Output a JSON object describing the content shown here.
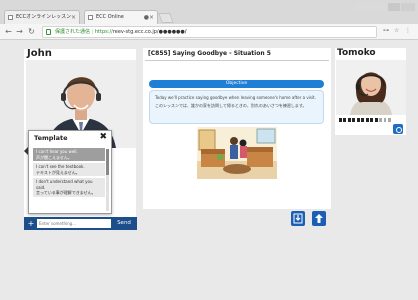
{
  "browser": {
    "tabs": [
      {
        "label": "ECCオンラインレッスン"
      },
      {
        "label": "ECC Online"
      }
    ],
    "address": {
      "secure_label": "保護された通信",
      "protocol": "https://",
      "url_host": "reev-stg.ecc.co.jp/",
      "url_masked": "●●●●●●/"
    }
  },
  "left_panel": {
    "name": "John"
  },
  "template_popup": {
    "title": "Template",
    "items": [
      {
        "en": "I can't hear you well.",
        "ja": "声が聞こえません。"
      },
      {
        "en": "I can't see the textbook.",
        "ja": "テキストが見えません。"
      },
      {
        "en": "I don't understand what you said.",
        "ja": "言っている事が理解できません。"
      }
    ]
  },
  "chat": {
    "placeholder": "Enter something...",
    "send_label": "Send"
  },
  "center_panel": {
    "title": "[C855] Saying Goodbye - Situation 5",
    "objective_label": "Objective",
    "objective_en": "Today we'll practice saying goodbye when leaving someone's home after a visit.",
    "objective_ja": "このレッスンでは、誰かの家を訪問して帰るときの、別れのあいさつを練習します。"
  },
  "right_panel": {
    "name": "Tomoko",
    "volume_level": 0.75
  },
  "icons": {
    "download": "download-icon",
    "upload": "up-arrow-icon",
    "camera": "camera-icon"
  },
  "colors": {
    "accent": "#1e7fd6",
    "chatbar": "#1c4e8c",
    "button": "#1a5fb4"
  }
}
